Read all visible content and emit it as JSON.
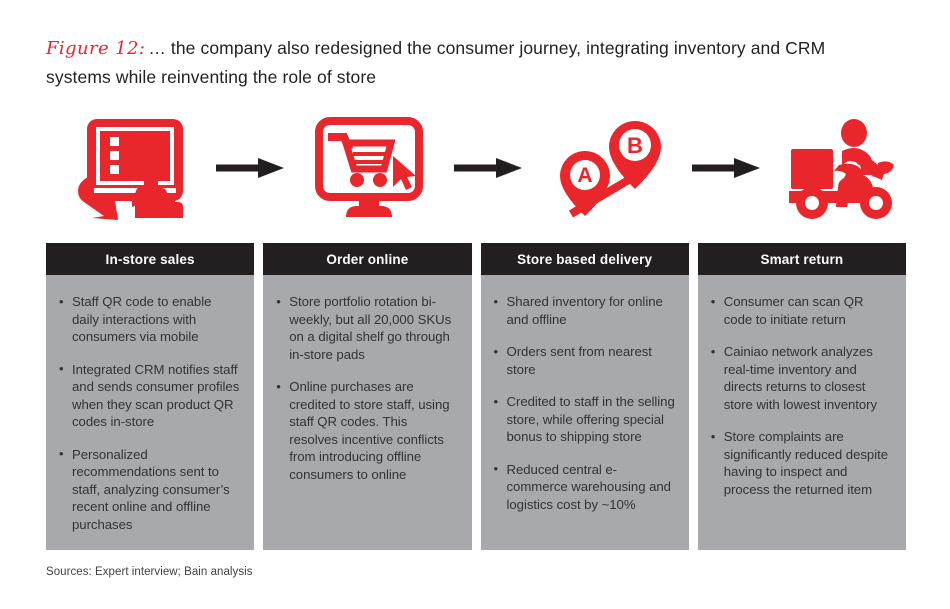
{
  "figure": {
    "label": "Figure 12:",
    "title": "… the company also redesigned the consumer journey, integrating inventory and CRM systems while reinventing the role of store"
  },
  "colors": {
    "accent_red": "#e8262c",
    "header_black": "#231f20",
    "panel_gray": "#a7a9ac",
    "arrow_black": "#231f20"
  },
  "icons": [
    {
      "name": "tablet-touch-scan-icon",
      "alt": "Hand touching a tablet screen"
    },
    {
      "name": "monitor-shopping-cart-cursor-icon",
      "alt": "Desktop monitor showing shopping cart with cursor"
    },
    {
      "name": "map-pins-route-icon",
      "alt": "Map pins A and B connected by a route",
      "pin_a_label": "A",
      "pin_b_label": "B"
    },
    {
      "name": "delivery-scooter-icon",
      "alt": "Delivery rider on a scooter with cargo box"
    }
  ],
  "arrows": [
    {
      "name": "flow-arrow-1"
    },
    {
      "name": "flow-arrow-2"
    },
    {
      "name": "flow-arrow-3"
    }
  ],
  "columns": [
    {
      "header": "In-store sales",
      "bullets": [
        "Staff QR code to enable daily interactions with consumers via mobile",
        "Integrated CRM notifies staff and sends consumer profiles when they scan product QR codes in-store",
        "Personalized recommendations sent to staff, analyzing consumer’s recent online and offline purchases"
      ]
    },
    {
      "header": "Order online",
      "bullets": [
        "Store portfolio rotation bi-weekly, but all 20,000 SKUs on a digital shelf go through in-store pads",
        "Online purchases are credited to store staff, using staff QR codes. This resolves incentive conflicts from introducing offline consumers to online"
      ]
    },
    {
      "header": "Store based delivery",
      "bullets": [
        "Shared inventory for online and offline",
        "Orders sent from nearest store",
        "Credited to staff in the selling store, while offering special bonus to shipping store",
        "Reduced central e-commerce warehousing and logistics cost by ~10%"
      ]
    },
    {
      "header": "Smart return",
      "bullets": [
        "Consumer can scan QR code to initiate return",
        "Cainiao network analyzes real-time inventory and directs returns to closest store with lowest inventory",
        "Store complaints are significantly reduced despite having to inspect and process the returned item"
      ]
    }
  ],
  "source": "Sources: Expert interview; Bain analysis"
}
